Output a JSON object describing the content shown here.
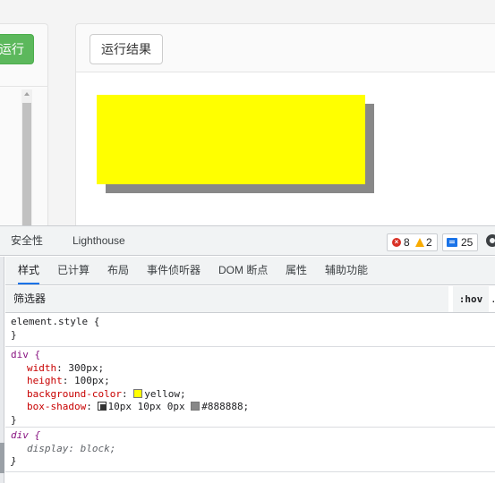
{
  "editor": {
    "run_button_label": "运行",
    "result_tab_label": "运行结果"
  },
  "demo_box": {
    "background": "#ffff00",
    "shadow_color": "#888888"
  },
  "devtools": {
    "top_tabs": [
      "安全性",
      "Lighthouse"
    ],
    "counters": {
      "errors": "8",
      "warnings": "2",
      "messages": "25"
    },
    "sub_tabs": [
      "样式",
      "已计算",
      "布局",
      "事件侦听器",
      "DOM 断点",
      "属性",
      "辅助功能"
    ],
    "active_sub_tab": "样式",
    "filter_placeholder": "筛选器",
    "hov_label": ":hov",
    "filter_more": ".",
    "rules": {
      "element_style": {
        "selector": "element.style {",
        "close": "}"
      },
      "div_rule": {
        "selector": "div {",
        "props": [
          {
            "name": "width",
            "value": "300px;"
          },
          {
            "name": "height",
            "value": "100px;"
          },
          {
            "name": "background-color",
            "value": "yellow;",
            "swatch": "#ffff00"
          },
          {
            "name": "box-shadow",
            "value": "10px 10px 0px",
            "color_value": "#888888;",
            "swatch": "#888888"
          }
        ],
        "close": "}"
      },
      "ua_rule": {
        "selector": "div {",
        "props": [
          {
            "name": "display",
            "value": "block;"
          }
        ],
        "close": "}"
      }
    }
  }
}
